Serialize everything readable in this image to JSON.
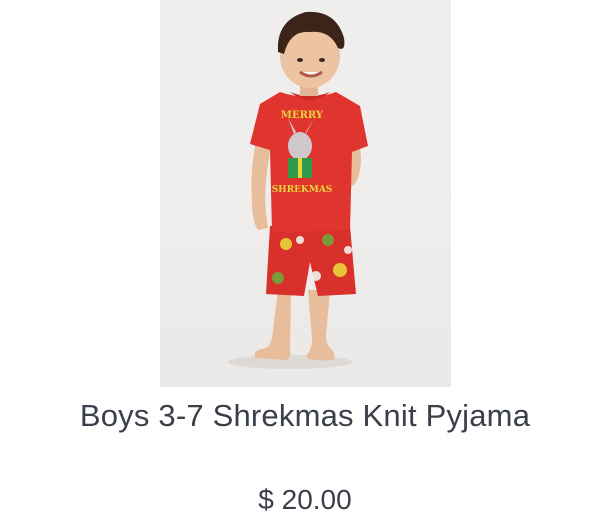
{
  "product": {
    "title": "Boys 3-7 Shrekmas Knit Pyjama",
    "price": "$ 20.00",
    "image": {
      "shirt_print_top": "MERRY",
      "shirt_print_bottom": "SHREKMAS",
      "shirt_color": "#e0352f",
      "shorts_color": "#d9302c",
      "accent_color": "#e8d53a",
      "gift_color": "#2e9a4a"
    }
  }
}
